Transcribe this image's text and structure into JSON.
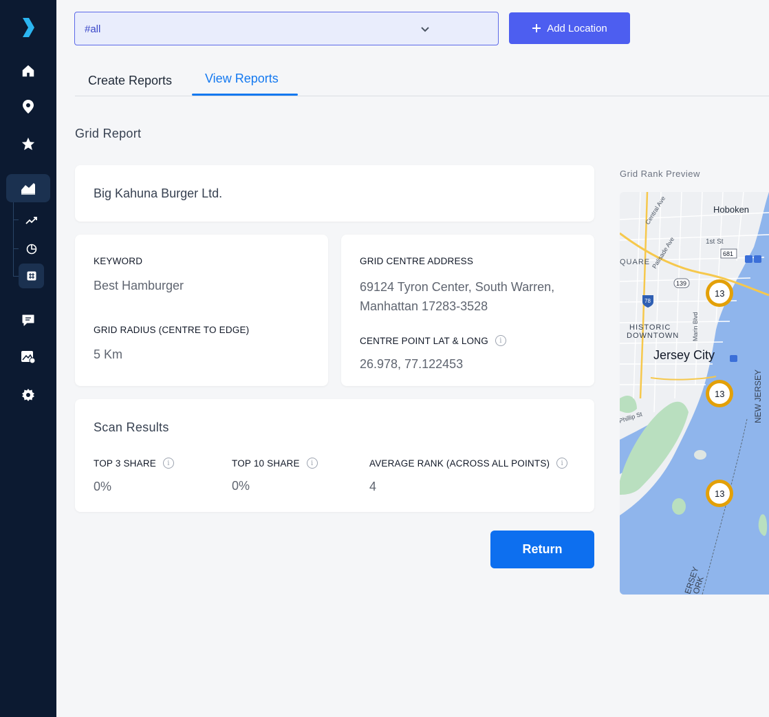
{
  "location_select": {
    "value": "#all"
  },
  "add_location": {
    "label": "Add Location"
  },
  "tabs": [
    {
      "label": "Create Reports",
      "active": false
    },
    {
      "label": "View Reports",
      "active": true
    }
  ],
  "section_title": "Grid Report",
  "business_name": "Big Kahuna Burger Ltd.",
  "keyword": {
    "label": "KEYWORD",
    "value": "Best Hamburger"
  },
  "grid_radius": {
    "label": "GRID RADIUS (CENTRE TO EDGE)",
    "value": "5 Km"
  },
  "grid_centre": {
    "label": "GRID CENTRE ADDRESS",
    "line1": "69124 Tyron Center, South Warren,",
    "line2": "Manhattan 17283-3528"
  },
  "centre_point": {
    "label": "CENTRE POINT LAT & LONG",
    "value": "26.978,  77.122453"
  },
  "scan_results": {
    "title": "Scan Results",
    "top3": {
      "label": "TOP 3 SHARE",
      "value": "0%"
    },
    "top10": {
      "label": "TOP 10 SHARE",
      "value": "0%"
    },
    "avg_rank": {
      "label": "AVERAGE RANK (ACROSS ALL POINTS)",
      "value": "4"
    }
  },
  "return_button": {
    "label": "Return"
  },
  "map": {
    "title": "Grid Rank Preview",
    "labels": {
      "hoboken": "Hoboken",
      "jersey_city": "Jersey City",
      "historic": "HISTORIC",
      "downtown": "DOWNTOWN",
      "quare": "QUARE",
      "central_ave": "Central Ave",
      "palisade_ave": "Palisade Ave",
      "first_st": "1st St",
      "marin_blvd": "Marin Blvd",
      "phillip_st": "Phillip St",
      "new_jersey": "NEW JERSEY",
      "ersey": "ERSEY",
      "ork": "ORK",
      "shield_139": "139",
      "shield_78": "78",
      "shield_681": "681"
    },
    "markers": [
      {
        "rank": "13"
      },
      {
        "rank": "13"
      },
      {
        "rank": "13"
      }
    ],
    "colors": {
      "marker_ring": "#e3a008",
      "water": "#8fb5ec",
      "land": "#eef0f3",
      "park": "#b9dfbf"
    }
  },
  "sidebar": {
    "icons": [
      "logo-icon",
      "home-icon",
      "location-pin-icon",
      "star-icon",
      "analytics-icon",
      "trend-icon",
      "pie-chart-icon",
      "grid-icon",
      "chat-icon",
      "image-icon",
      "settings-icon"
    ]
  }
}
